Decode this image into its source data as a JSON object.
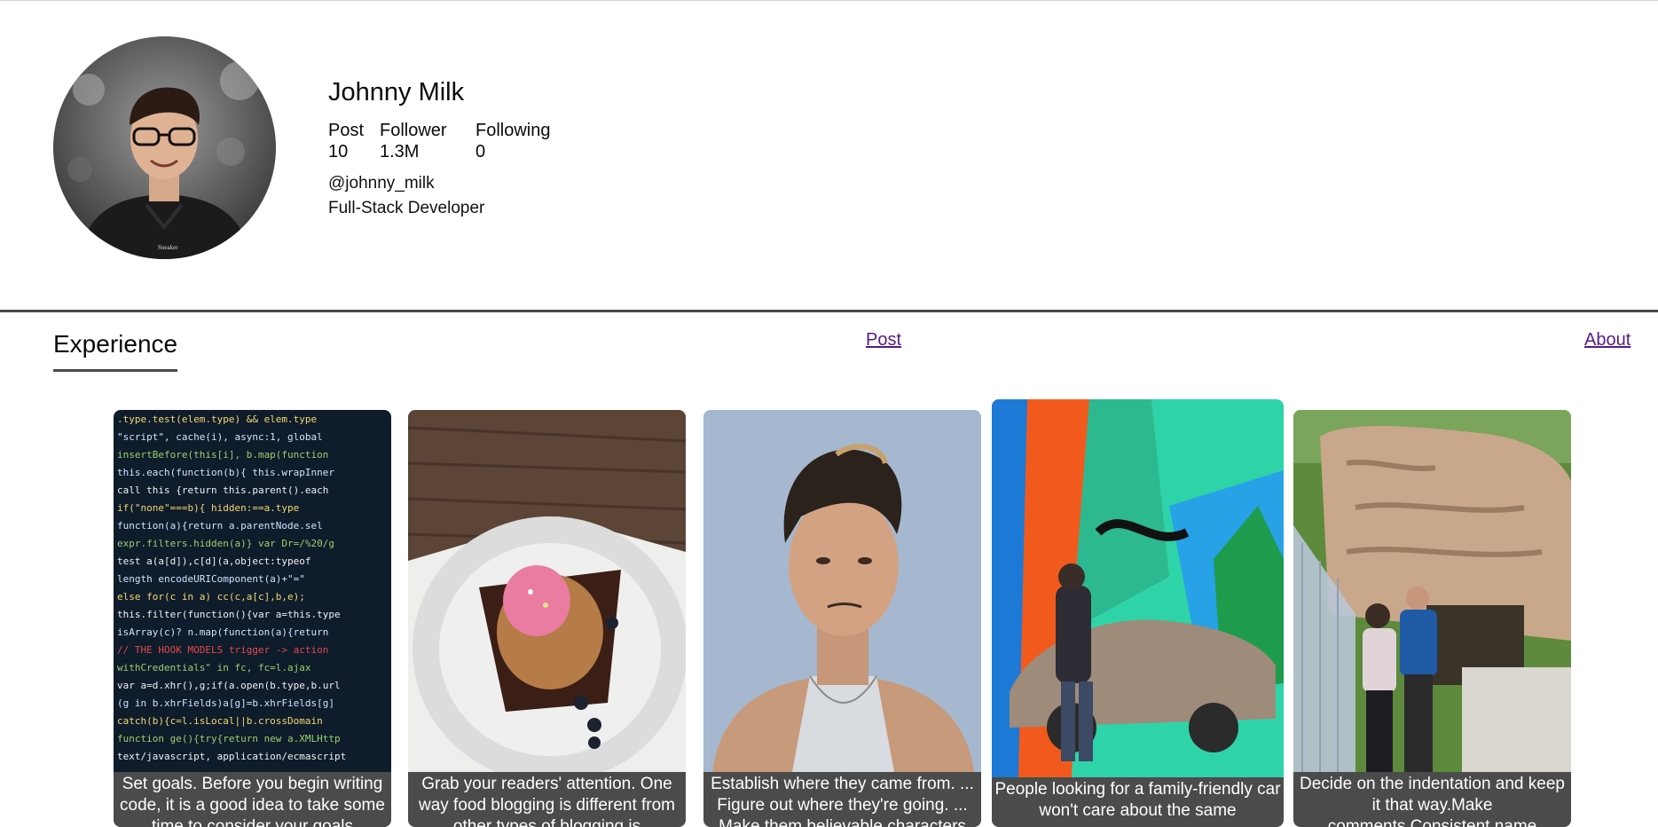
{
  "profile": {
    "name": "Johnny Milk",
    "stats": {
      "post_label": "Post",
      "post_value": "10",
      "follower_label": "Follower",
      "follower_value": "1.3M",
      "following_label": "Following",
      "following_value": "0"
    },
    "handle": "@johnny_milk",
    "bio": "Full-Stack Developer"
  },
  "tabs": {
    "experience": "Experience",
    "post": "Post",
    "about": "About"
  },
  "cards": [
    {
      "caption": "Set goals. Before you begin writing code, it is a good idea to take some time to consider your goals"
    },
    {
      "caption": "Grab your readers' attention. One way food blogging is different from other types of blogging is"
    },
    {
      "caption": "Establish where they came from. ... Figure out where they're going. ... Make them believable characters"
    },
    {
      "caption": "People looking for a family-friendly car won't care about the same"
    },
    {
      "caption": "Decide on the indentation and keep it that way.Make comments.Consistent name"
    }
  ]
}
